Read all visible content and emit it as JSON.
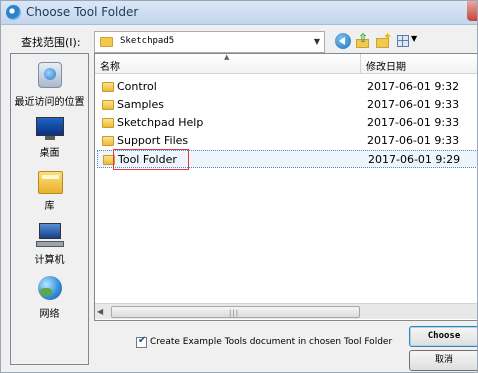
{
  "window": {
    "title": "Choose Tool Folder"
  },
  "lookin": {
    "label": "查找范围(I):",
    "value": "Sketchpad5"
  },
  "toolbar": {
    "icons": [
      "back-icon",
      "up-folder-icon",
      "new-folder-icon",
      "view-menu-icon"
    ]
  },
  "places": [
    {
      "label": "最近访问的位置",
      "icon": "recent-places-icon"
    },
    {
      "label": "桌面",
      "icon": "desktop-icon"
    },
    {
      "label": "库",
      "icon": "libraries-icon"
    },
    {
      "label": "计算机",
      "icon": "computer-icon"
    },
    {
      "label": "网络",
      "icon": "network-icon"
    }
  ],
  "filelist": {
    "columns": {
      "name": "名称",
      "date": "修改日期"
    },
    "rows": [
      {
        "name": "Control",
        "date": "2017-06-01 9:32"
      },
      {
        "name": "Samples",
        "date": "2017-06-01 9:33"
      },
      {
        "name": "Sketchpad Help",
        "date": "2017-06-01 9:33"
      },
      {
        "name": "Support Files",
        "date": "2017-06-01 9:33"
      },
      {
        "name": "Tool Folder",
        "date": "2017-06-01 9:29",
        "selected": true
      }
    ]
  },
  "footer": {
    "checkbox_label": "Create Example Tools document in chosen Tool Folder",
    "checkbox_checked": true,
    "choose_label": "Choose",
    "cancel_label": "取消"
  },
  "colors": {
    "selection_highlight": "#e33b3b",
    "title_text": "#1e395b"
  }
}
